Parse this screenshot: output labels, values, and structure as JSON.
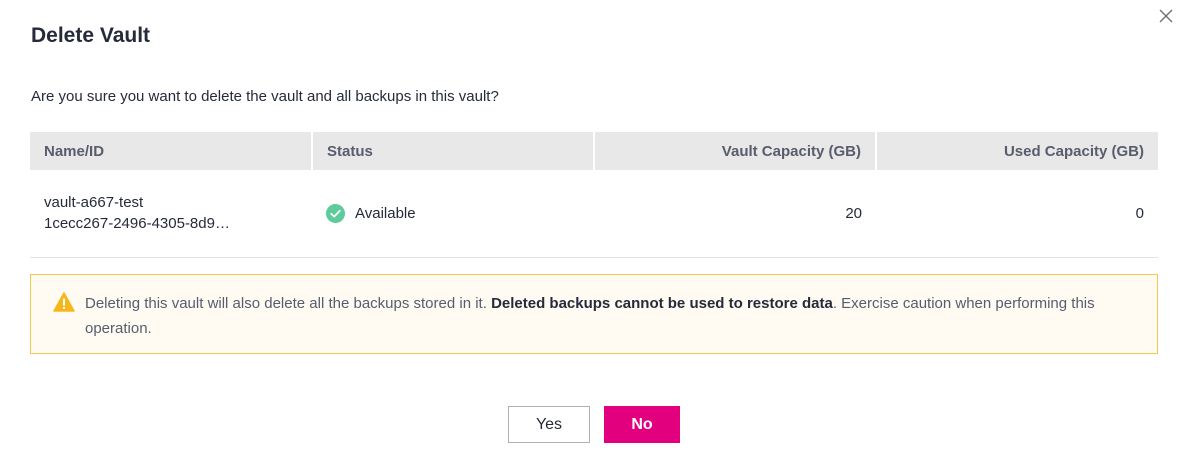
{
  "dialog": {
    "title": "Delete Vault",
    "question": "Are you sure you want to delete the vault and all backups in this vault?",
    "close_icon": "close-icon"
  },
  "table": {
    "headers": {
      "name_id": "Name/ID",
      "status": "Status",
      "vault_capacity": "Vault Capacity (GB)",
      "used_capacity": "Used Capacity (GB)"
    },
    "rows": [
      {
        "name": "vault-a667-test",
        "id": "1cecc267-2496-4305-8d9…",
        "status": "Available",
        "status_icon": "check-circle-icon",
        "vault_capacity": "20",
        "used_capacity": "0"
      }
    ]
  },
  "warning": {
    "icon": "warning-triangle-icon",
    "text_before": "Deleting this vault will also delete all the backups stored in it. ",
    "text_bold": "Deleted backups cannot be used to restore data",
    "text_after": ". Exercise caution when performing this operation."
  },
  "buttons": {
    "yes_label": "Yes",
    "no_label": "No"
  },
  "colors": {
    "primary": "#e3007f",
    "success": "#5dcb9b",
    "warning": "#f6b71c",
    "warning_bg": "#fffbf3",
    "warning_border": "#f5c849"
  }
}
